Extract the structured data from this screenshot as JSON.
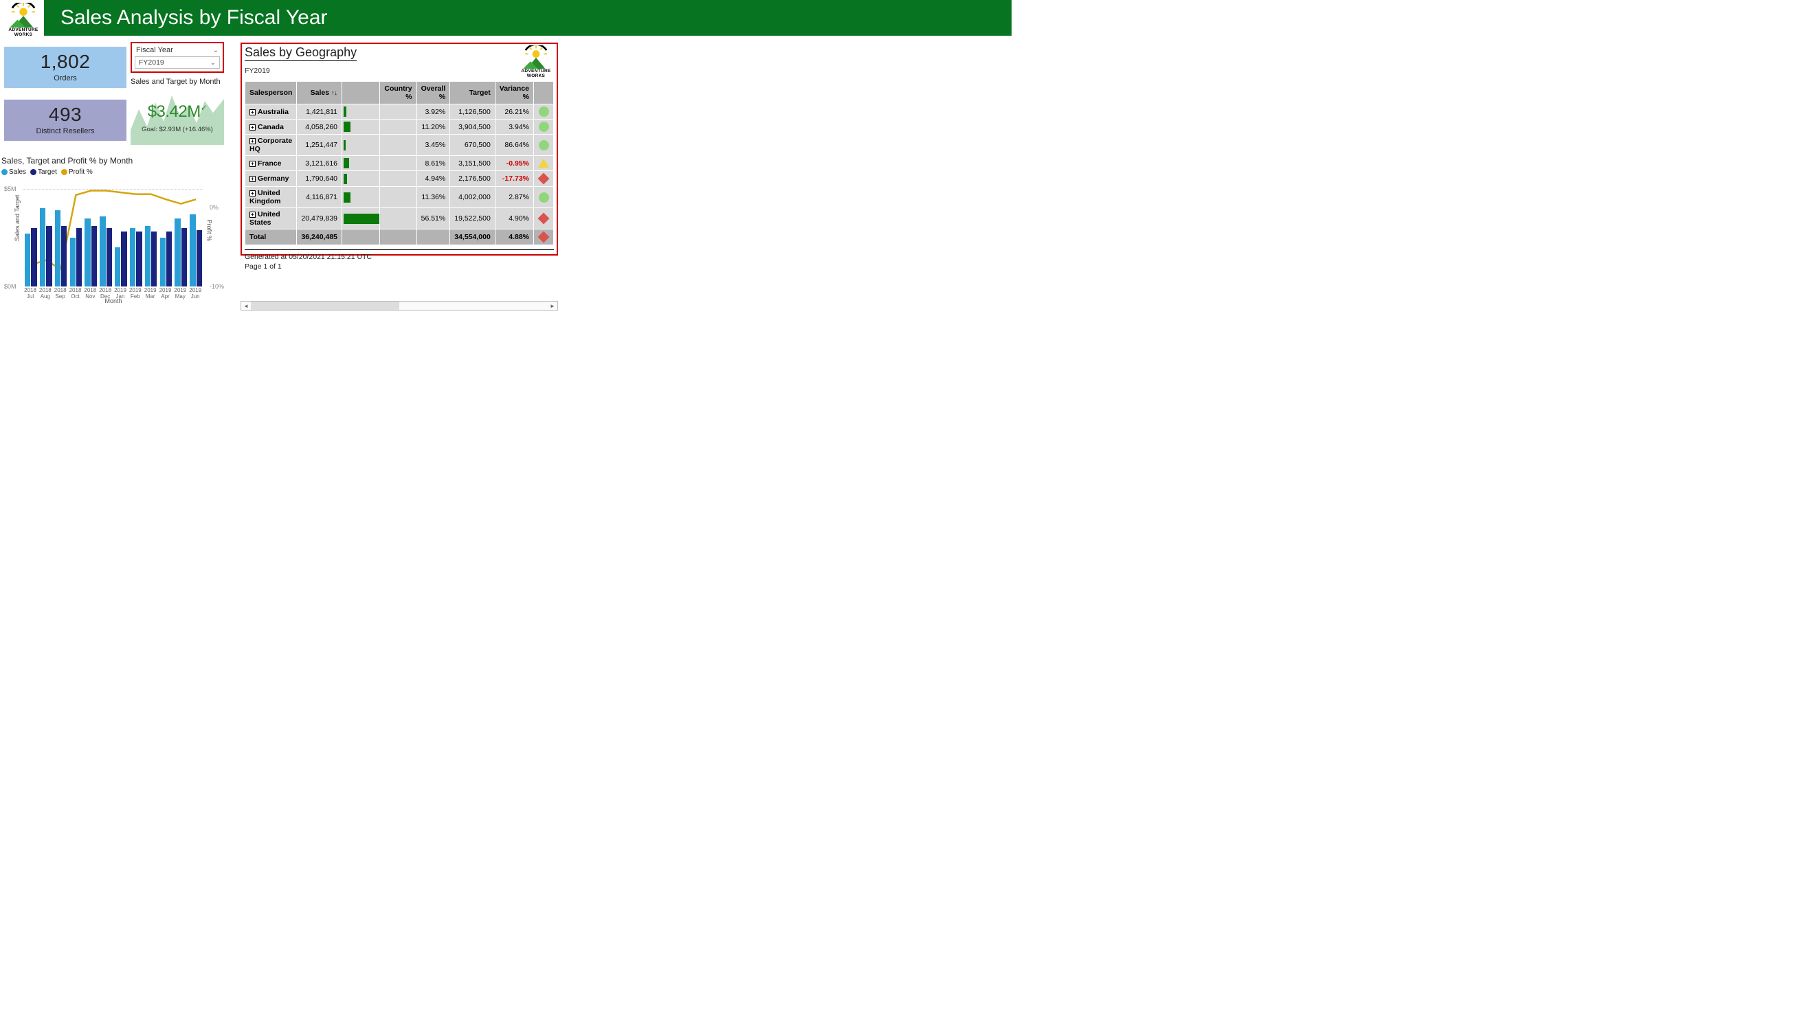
{
  "header": {
    "title": "Sales Analysis by Fiscal Year"
  },
  "logo": {
    "brand_top": "ADVENTURE",
    "brand_bottom": "WORKS"
  },
  "cards": {
    "orders": {
      "value": "1,802",
      "label": "Orders"
    },
    "resellers": {
      "value": "493",
      "label": "Distinct Resellers"
    }
  },
  "slicer": {
    "label": "Fiscal Year",
    "value": "FY2019"
  },
  "kpi": {
    "title": "Sales and Target by Month",
    "value": "$3.42M",
    "goal": "Goal: $2.93M (+16.46%)"
  },
  "combo": {
    "title": "Sales, Target and Profit % by Month",
    "legend": {
      "sales": "Sales",
      "target": "Target",
      "profit": "Profit %"
    },
    "y_left_label": "Sales and Target",
    "y_right_label": "Profit %",
    "x_label": "Month",
    "y_left_ticks": [
      "$5M",
      "$0M"
    ],
    "y_right_ticks": [
      "0%",
      "-10%"
    ]
  },
  "geo": {
    "title": "Sales by Geography",
    "subtitle": "FY2019",
    "columns": {
      "salesperson": "Salesperson",
      "sales": "Sales",
      "country_pct": "Country %",
      "overall_pct": "Overall %",
      "target": "Target",
      "variance_pct": "Variance %"
    },
    "rows": [
      {
        "name": "Australia",
        "sales": "1,421,811",
        "bar": 7,
        "country": "",
        "overall": "3.92%",
        "target": "1,126,500",
        "variance": "26.21%",
        "neg": false,
        "shape": "circle"
      },
      {
        "name": "Canada",
        "sales": "4,058,260",
        "bar": 20,
        "country": "",
        "overall": "11.20%",
        "target": "3,904,500",
        "variance": "3.94%",
        "neg": false,
        "shape": "circle"
      },
      {
        "name": "Corporate HQ",
        "sales": "1,251,447",
        "bar": 6,
        "country": "",
        "overall": "3.45%",
        "target": "670,500",
        "variance": "86.64%",
        "neg": false,
        "shape": "circle"
      },
      {
        "name": "France",
        "sales": "3,121,616",
        "bar": 15,
        "country": "",
        "overall": "8.61%",
        "target": "3,151,500",
        "variance": "-0.95%",
        "neg": true,
        "shape": "triangle"
      },
      {
        "name": "Germany",
        "sales": "1,790,640",
        "bar": 9,
        "country": "",
        "overall": "4.94%",
        "target": "2,176,500",
        "variance": "-17.73%",
        "neg": true,
        "shape": "diamond"
      },
      {
        "name": "United Kingdom",
        "sales": "4,116,871",
        "bar": 20,
        "country": "",
        "overall": "11.36%",
        "target": "4,002,000",
        "variance": "2.87%",
        "neg": false,
        "shape": "circle"
      },
      {
        "name": "United States",
        "sales": "20,479,839",
        "bar": 100,
        "country": "",
        "overall": "56.51%",
        "target": "19,522,500",
        "variance": "4.90%",
        "neg": false,
        "shape": "diamond"
      }
    ],
    "total": {
      "label": "Total",
      "sales": "36,240,485",
      "target": "34,554,000",
      "variance": "4.88%",
      "shape": "diamond"
    },
    "footer_line1": "Generated at 05/20/2021 21:15:21 UTC",
    "footer_line2": "Page 1 of 1"
  },
  "chart_data": [
    {
      "type": "bar",
      "title": "Sales, Target and Profit % by Month",
      "categories": [
        "2018 Jul",
        "2018 Aug",
        "2018 Sep",
        "2018 Oct",
        "2018 Nov",
        "2018 Dec",
        "2019 Jan",
        "2019 Feb",
        "2019 Mar",
        "2019 Apr",
        "2019 May",
        "2019 Jun"
      ],
      "series": [
        {
          "name": "Sales",
          "values": [
            2.7,
            4.0,
            3.9,
            2.5,
            3.5,
            3.6,
            2.0,
            3.0,
            3.1,
            2.5,
            3.5,
            3.7
          ],
          "unit": "$M"
        },
        {
          "name": "Target",
          "values": [
            3.0,
            3.1,
            3.1,
            3.0,
            3.1,
            3.0,
            2.8,
            2.8,
            2.8,
            2.8,
            3.0,
            2.9
          ],
          "unit": "$M"
        },
        {
          "name": "Profit %",
          "values": [
            -7.5,
            -7.0,
            -8.0,
            0.5,
            1.0,
            1.0,
            0.8,
            0.6,
            0.6,
            0.0,
            -0.5,
            0.0
          ],
          "unit": "%"
        }
      ],
      "xlabel": "Month",
      "ylabel_left": "Sales and Target",
      "ylabel_right": "Profit %",
      "ylim_left": [
        0,
        5
      ],
      "ylim_right": [
        -10,
        1
      ]
    },
    {
      "type": "area",
      "title": "Sales and Target by Month (KPI sparkline)",
      "value": 3.42,
      "goal": 2.93,
      "pct": 16.46,
      "unit": "$M"
    },
    {
      "type": "table",
      "title": "Sales by Geography",
      "rows": [
        [
          "Australia",
          1421811,
          3.92,
          1126500,
          26.21
        ],
        [
          "Canada",
          4058260,
          11.2,
          3904500,
          3.94
        ],
        [
          "Corporate HQ",
          1251447,
          3.45,
          670500,
          86.64
        ],
        [
          "France",
          3121616,
          8.61,
          3151500,
          -0.95
        ],
        [
          "Germany",
          1790640,
          4.94,
          2176500,
          -17.73
        ],
        [
          "United Kingdom",
          4116871,
          11.36,
          4002000,
          2.87
        ],
        [
          "United States",
          20479839,
          56.51,
          19522500,
          4.9
        ]
      ],
      "total": [
        "Total",
        36240485,
        null,
        34554000,
        4.88
      ],
      "columns": [
        "Salesperson",
        "Sales",
        "Overall %",
        "Target",
        "Variance %"
      ]
    }
  ]
}
